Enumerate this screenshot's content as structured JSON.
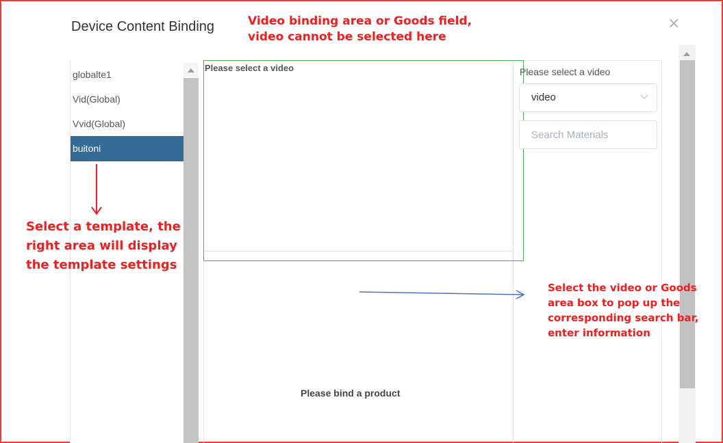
{
  "dialog": {
    "title": "Device Content Binding",
    "close_glyph": "×"
  },
  "templates": [
    {
      "label": "globalte1",
      "selected": false
    },
    {
      "label": "Vid(Global)",
      "selected": false
    },
    {
      "label": "Vvid(Global)",
      "selected": false
    },
    {
      "label": "buitoni",
      "selected": true
    }
  ],
  "canvas": {
    "video_area_label": "Please select a video",
    "goods_area_label": "Please bind a product"
  },
  "right_panel": {
    "select_label": "Please select a video",
    "select_value": "video",
    "search_placeholder": "Search Materials"
  },
  "annotations": {
    "top_line1": "Video binding area or Goods field,",
    "top_line2": "video cannot be selected here",
    "left_line1": "Select a template, the",
    "left_line2": "right area will display",
    "left_line3": "the template settings",
    "right_line1": "Select the video or Goods",
    "right_line2": "area box to pop up the",
    "right_line3": "corresponding search bar,",
    "right_line4": "enter information"
  },
  "colors": {
    "annotation_red": "#f21d1d",
    "selected_item_bg": "#336b96",
    "video_box_border": "#4caf50",
    "arrow_blue": "#4a72c4",
    "frame_border": "#ee3b3b"
  }
}
